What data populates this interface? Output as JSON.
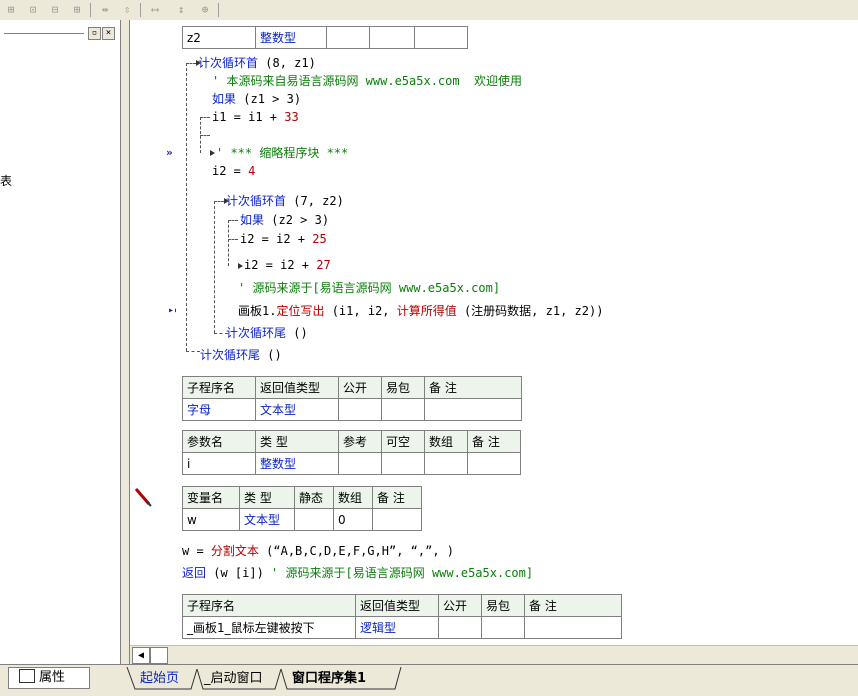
{
  "toolbar": {
    "icons": [
      "align-left-icon",
      "align-center-icon",
      "align-top-icon",
      "align-right-icon",
      "space-h-icon",
      "space-v-icon",
      "width-icon",
      "height-icon",
      "size-icon"
    ]
  },
  "left_panel": {
    "min_btn": "▫",
    "close_btn": "×",
    "partial_char": "表"
  },
  "var_table": {
    "name": "z2",
    "type": "整数型"
  },
  "code": {
    "l1_kw": "计次循环首",
    "l1_rest": " (8, z1)",
    "l2_comment": "' 本源码来自易语言源码网 www.e5a5x.com  欢迎使用",
    "l3_kw": "如果",
    "l3_rest": " (z1 > 3)",
    "l4_a": "i1 = i1 + ",
    "l4_num": "33",
    "l5_comment": "' *** 缩略程序块 ***",
    "l6_a": "i2 = ",
    "l6_num": "4",
    "l7_kw": "计次循环首",
    "l7_rest": " (7, z2)",
    "l8_kw": "如果",
    "l8_rest": " (z2 > 3)",
    "l9_a": "i2 = i2 + ",
    "l9_num": "25",
    "l10_a": "i2 = i2 + ",
    "l10_num": "27",
    "l11_comment": "' 源码来源于[易语言源码网 www.e5a5x.com]",
    "l12_obj": "画板1.",
    "l12_method": "定位写出",
    "l12_args1": " (i1, i2, ",
    "l12_fn": "计算所得值",
    "l12_args2": " (注册码数据, z1, z2))",
    "l13_kw": "计次循环尾",
    "l13_rest": " ()",
    "l14_kw": "计次循环尾",
    "l14_rest": " ()"
  },
  "sub_table": {
    "h": [
      "子程序名",
      "返回值类型",
      "公开",
      "易包",
      "备 注"
    ],
    "r": [
      "字母",
      "文本型",
      "",
      "",
      ""
    ]
  },
  "param_table": {
    "h": [
      "参数名",
      "类 型",
      "参考",
      "可空",
      "数组",
      "备 注"
    ],
    "r": [
      "i",
      "整数型",
      "",
      "",
      "",
      ""
    ]
  },
  "local_table": {
    "h": [
      "变量名",
      "类 型",
      "静态",
      "数组",
      "备 注"
    ],
    "r": [
      "w",
      "文本型",
      "",
      "0",
      ""
    ]
  },
  "code2": {
    "l1_a": "w = ",
    "l1_fn": "分割文本",
    "l1_rest": " (“A,B,C,D,E,F,G,H”, “,”, )",
    "l2_kw": "返回",
    "l2_rest": " (w [i]) ",
    "l2_comment": "' 源码来源于[易语言源码网 www.e5a5x.com]"
  },
  "sub_table2": {
    "h": [
      "子程序名",
      "返回值类型",
      "公开",
      "易包",
      "备 注"
    ],
    "r": [
      "_画板1_鼠标左键被按下",
      "逻辑型",
      "",
      "",
      ""
    ]
  },
  "bottom": {
    "prop_label": "属性",
    "tabs": [
      "起始页",
      "_启动窗口",
      "窗口程序集1"
    ]
  }
}
